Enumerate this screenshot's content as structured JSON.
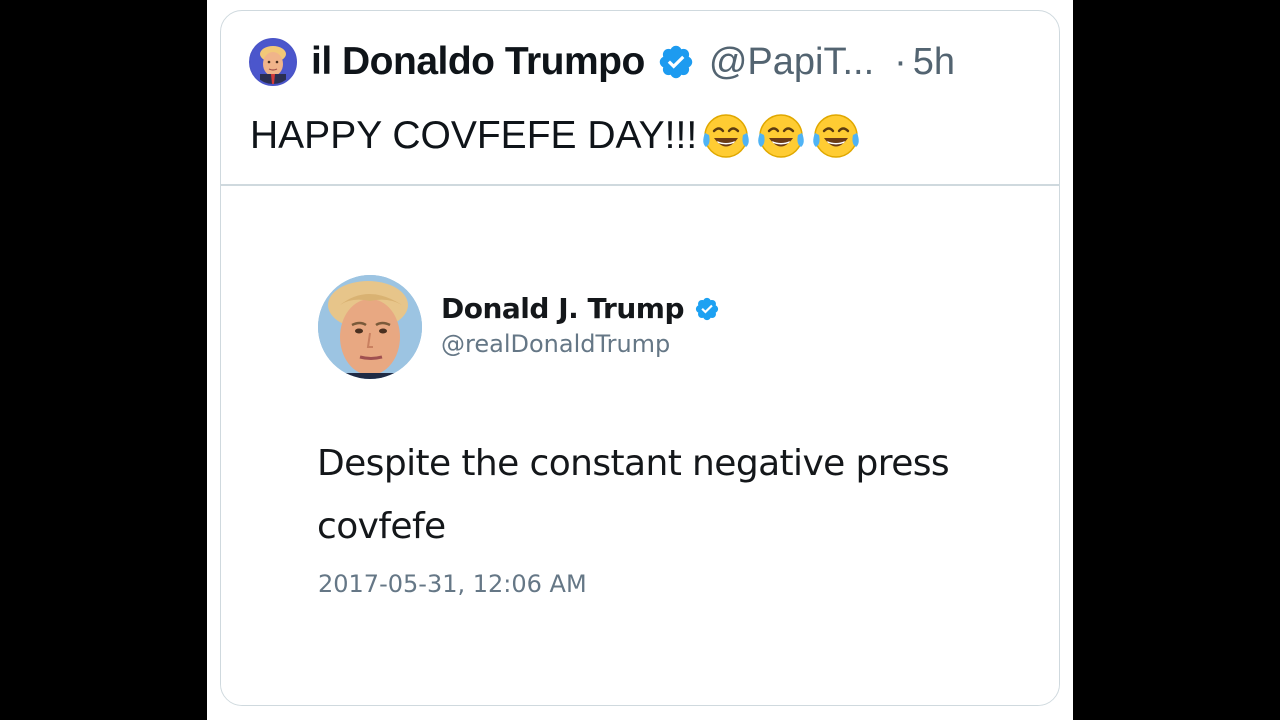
{
  "tweet": {
    "display_name": "il Donaldo Trumpo",
    "handle": "@PapiT...",
    "separator": "·",
    "time": "5h",
    "text": "HAPPY COVFEFE DAY!!!",
    "emojis": [
      "face-with-tears-of-joy",
      "face-with-tears-of-joy",
      "face-with-tears-of-joy"
    ],
    "avatar_icon": "profile-photo-icon",
    "verified_icon": "verified-badge-icon"
  },
  "quoted_tweet": {
    "display_name": "Donald J. Trump",
    "handle": "@realDonaldTrump",
    "text": "Despite the constant negative press covfefe",
    "date": "2017-05-31, 12:06 AM",
    "avatar_icon": "profile-photo-icon",
    "verified_icon": "verified-badge-icon"
  },
  "colors": {
    "background": "#000000",
    "card": "#ffffff",
    "border": "#cfd9de",
    "verified_blue": "#1d9bf0",
    "text_primary": "#0f1419",
    "text_secondary": "#536471"
  }
}
